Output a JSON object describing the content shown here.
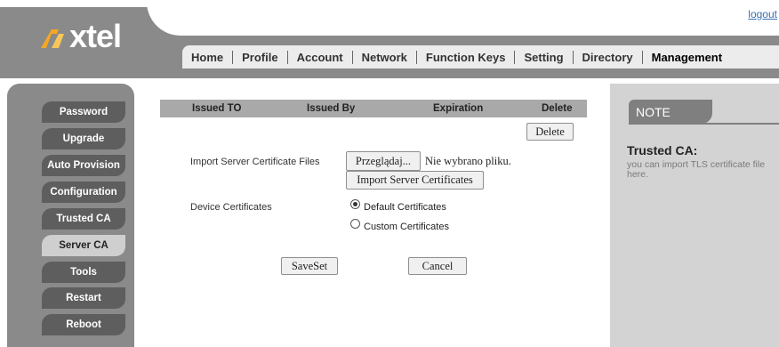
{
  "brand": {
    "logo_text": "xtel"
  },
  "header": {
    "logout": "logout"
  },
  "nav": [
    "Home",
    "Profile",
    "Account",
    "Network",
    "Function Keys",
    "Setting",
    "Directory",
    "Management"
  ],
  "sidebar": {
    "items": [
      {
        "label": "Password"
      },
      {
        "label": "Upgrade"
      },
      {
        "label": "Auto Provision"
      },
      {
        "label": "Configuration"
      },
      {
        "label": "Trusted CA"
      },
      {
        "label": "Server CA"
      },
      {
        "label": "Tools"
      },
      {
        "label": "Restart"
      },
      {
        "label": "Reboot"
      }
    ]
  },
  "table": {
    "headers": [
      "Issued TO",
      "Issued By",
      "Expiration",
      "Delete"
    ],
    "delete_button": "Delete"
  },
  "import": {
    "label": "Import Server Certificate Files",
    "browse_button": "Przeglądaj...",
    "file_status": "Nie wybrano pliku.",
    "submit_button": "Import Server Certificates"
  },
  "device": {
    "label": "Device Certificates",
    "options": [
      "Default Certificates",
      "Custom Certificates"
    ],
    "selected": "Default Certificates"
  },
  "actions": {
    "save": "SaveSet",
    "cancel": "Cancel"
  },
  "note": {
    "tab": "NOTE",
    "title": "Trusted CA:",
    "text": "you can import TLS certificate file here."
  },
  "colors": {
    "header_gray": "#8a8a8a",
    "sidebar_button": "#5e5e5e",
    "link": "#3a6fb0"
  }
}
